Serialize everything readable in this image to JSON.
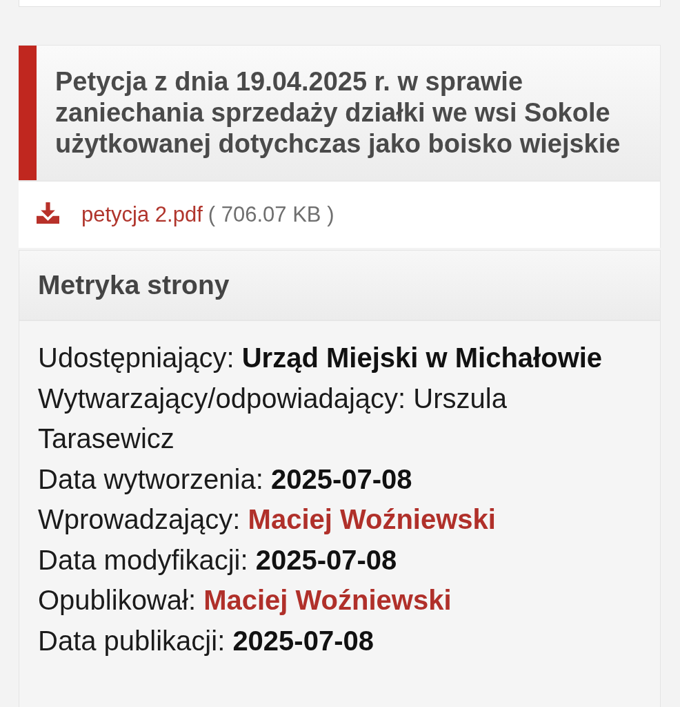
{
  "article": {
    "title": "Petycja z dnia 19.04.2025 r. w sprawie zaniechania sprzedaży działki we wsi Sokole użytkowanej dotychczas jako boisko wiejskie",
    "attachments": [
      {
        "file_name": "petycja 2.pdf",
        "size": "( 706.07 KB )"
      }
    ]
  },
  "metadata": {
    "heading": "Metryka strony",
    "rows": [
      {
        "kind": "bold",
        "label": "Udostępniający:",
        "value": "Urząd Miejski w Michałowie"
      },
      {
        "kind": "plain",
        "label": "Wytwarzający/odpowiadający:",
        "value": "Urszula Tarasewicz"
      },
      {
        "kind": "bold",
        "label": "Data wytworzenia:",
        "value": "2025-07-08"
      },
      {
        "kind": "link",
        "label": "Wprowadzający:",
        "value": "Maciej Woźniewski"
      },
      {
        "kind": "bold",
        "label": "Data modyfikacji:",
        "value": "2025-07-08"
      },
      {
        "kind": "link",
        "label": "Opublikował:",
        "value": "Maciej Woźniewski"
      },
      {
        "kind": "bold",
        "label": "Data publikacji:",
        "value": "2025-07-08"
      }
    ]
  }
}
